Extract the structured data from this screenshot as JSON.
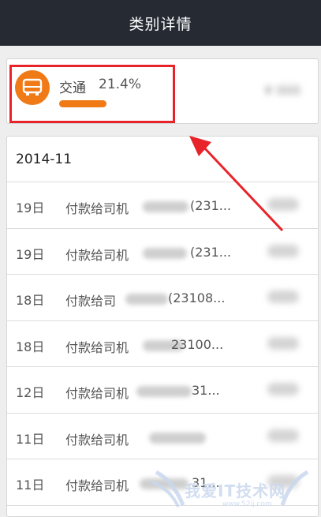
{
  "header": {
    "title": "类别详情"
  },
  "summary": {
    "category": "交通",
    "percent_label": "21.4%",
    "percent_value": 21.4,
    "icon": "bus-icon",
    "accent_color": "#f07a16",
    "highlight_color": "#e8242a"
  },
  "list": {
    "month": "2014-11",
    "transactions": [
      {
        "day": "19日",
        "desc_start": "付款给司机",
        "desc_end": "(231..."
      },
      {
        "day": "19日",
        "desc_start": "付款给司机",
        "desc_end": "(231..."
      },
      {
        "day": "18日",
        "desc_start": "付款给司",
        "desc_end": "(23108..."
      },
      {
        "day": "18日",
        "desc_start": "付款给司机",
        "desc_end": "23100..."
      },
      {
        "day": "12日",
        "desc_start": "付款给司机",
        "desc_end": "31..."
      },
      {
        "day": "11日",
        "desc_start": "付款给司机",
        "desc_end": ""
      },
      {
        "day": "11日",
        "desc_start": "付款给司机",
        "desc_end": "31..."
      }
    ]
  },
  "watermark": {
    "text": "我爱IT技术网",
    "url": "www.52ij.com"
  }
}
